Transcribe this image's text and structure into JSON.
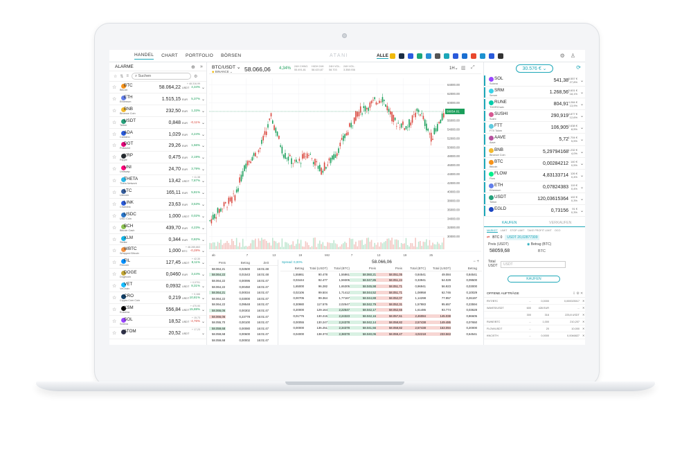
{
  "nav": {
    "tabs": [
      "HANDEL",
      "CHART",
      "PORTFOLIO",
      "BÖRSEN"
    ],
    "logo": "ATANI",
    "alle": "ALLE"
  },
  "colors": {
    "accent": "#1ca7b8",
    "up": "#1a9e5a",
    "down": "#d9453b"
  },
  "alarme": {
    "title": "ALARME",
    "search_placeholder": "Suchen"
  },
  "watchlist": [
    {
      "sym": "BTC",
      "name": "Bitcoin",
      "price": "58.064,22",
      "cur": "USDT",
      "chg": "4,34%",
      "top": "+ 48.316,99",
      "dir": "pos",
      "color": "#f7931a"
    },
    {
      "sym": "ETH",
      "name": "Ethereum",
      "price": "1.515,15",
      "cur": "EUR",
      "chg": "5,37%",
      "dir": "pos",
      "color": "#627eea"
    },
    {
      "sym": "BNB",
      "name": "Binance Coin",
      "price": "232,50",
      "cur": "EUR",
      "chg": "1,33%",
      "dir": "pos",
      "color": "#f3ba2f"
    },
    {
      "sym": "USDT",
      "name": "Tether",
      "price": "0,848",
      "cur": "EUR",
      "chg": "-0,11%",
      "dir": "neg",
      "color": "#26a17b"
    },
    {
      "sym": "ADA",
      "name": "Cardano",
      "price": "1,029",
      "cur": "EUR",
      "chg": "4,24%",
      "dir": "pos",
      "color": "#2a5ada"
    },
    {
      "sym": "DOT",
      "name": "Polkadot",
      "price": "29,26",
      "cur": "EUR",
      "chg": "1,56%",
      "dir": "pos",
      "color": "#e6007a"
    },
    {
      "sym": "XRP",
      "name": "Ripple",
      "price": "0,475",
      "cur": "EUR",
      "chg": "2,19%",
      "dir": "pos",
      "color": "#23292f"
    },
    {
      "sym": "UNI",
      "name": "Uniswap",
      "price": "24,70",
      "cur": "EUR",
      "chg": "3,79%",
      "dir": "pos",
      "color": "#ff007a"
    },
    {
      "sym": "THETA",
      "name": "Theta Network",
      "price": "13,42",
      "cur": "USDT",
      "chg": "7,87%",
      "top": "+ 11,38",
      "dir": "pos",
      "color": "#2ab8e6"
    },
    {
      "sym": "LTC",
      "name": "Litecoin",
      "price": "165,11",
      "cur": "EUR",
      "chg": "5,81%",
      "dir": "pos",
      "color": "#345d9d"
    },
    {
      "sym": "LINK",
      "name": "Chainlink",
      "price": "23,63",
      "cur": "EUR",
      "chg": "3,53%",
      "dir": "pos",
      "color": "#2a5ada"
    },
    {
      "sym": "USDC",
      "name": "USD Coin",
      "price": "1,000",
      "cur": "USDT",
      "chg": "0,02%",
      "dir": "pos",
      "color": "#2775ca"
    },
    {
      "sym": "BCH",
      "name": "Bitcoin Cash",
      "price": "439,70",
      "cur": "EUR",
      "chg": "4,23%",
      "dir": "pos",
      "color": "#8dc351"
    },
    {
      "sym": "XLM",
      "name": "Stellar",
      "price": "0,344",
      "cur": "EUR",
      "chg": "0,82%",
      "dir": "pos",
      "color": "#14b6e7"
    },
    {
      "sym": "WBTC",
      "name": "Wrapped Bitcoin",
      "price": "1,000",
      "cur": "BTC",
      "chg": "-0,28%",
      "top": "+ 48.285,863",
      "dir": "neg",
      "color": "#f09242"
    },
    {
      "sym": "FIL",
      "name": "Filecoin",
      "price": "127,45",
      "cur": "USDT",
      "chg": "8,11%",
      "top": "+ 42,30",
      "dir": "pos",
      "color": "#0090ff"
    },
    {
      "sym": "DOGE",
      "name": "Dogecoin",
      "price": "0,0460",
      "cur": "EUR",
      "chg": "3,44%",
      "dir": "pos",
      "color": "#c2a633"
    },
    {
      "sym": "VET",
      "name": "VeChain",
      "price": "0,0932",
      "cur": "USDT",
      "chg": "8,31%",
      "top": "+ 0,0701",
      "dir": "pos",
      "color": "#15bdff"
    },
    {
      "sym": "CRO",
      "name": "Crypto.Com Coin",
      "price": "0,219",
      "cur": "USDT",
      "chg": "10,81%",
      "top": "+ 0,166",
      "dir": "pos",
      "color": "#103f68"
    },
    {
      "sym": "KSM",
      "name": "Kusama",
      "price": "556,84",
      "cur": "USDT",
      "chg": "15,88%",
      "top": "+ 470,90",
      "dir": "pos",
      "color": "#000"
    },
    {
      "sym": "SOL",
      "name": "Solana",
      "price": "18,52",
      "cur": "USDT",
      "chg": "-4,76%",
      "top": "+ 15,73",
      "dir": "neg",
      "color": "#9945ff"
    },
    {
      "sym": "ATOM",
      "name": "",
      "price": "20,52",
      "cur": "USDT",
      "chg": "",
      "top": "+ 17,23",
      "dir": "pos",
      "color": "#2e3148"
    }
  ],
  "chart": {
    "pair": "BTC/USDT",
    "exchange": "BINANCE",
    "price": "58.066,06",
    "pct": "4,34%",
    "interval": "1H",
    "stats": [
      {
        "l": "24H CHNG.",
        "v": "55.491,81"
      },
      {
        "l": "HIGH 24H",
        "v": "58.420,87"
      },
      {
        "l": "24H VOL.",
        "v": "58.703"
      },
      {
        "l": "24H VOL.",
        "v": "3.358.936"
      }
    ],
    "current_label": "58054.01",
    "x_labels": [
      "ab",
      "7",
      "13",
      "19",
      "Mrz",
      "7",
      "13",
      "19",
      "25"
    ],
    "y_labels": [
      "64000.00",
      "62000.00",
      "60000.00",
      "58000.00",
      "56000.00",
      "54000.00",
      "52000.00",
      "50000.00",
      "48000.00",
      "46000.00",
      "44000.00",
      "42000.00",
      "40000.00",
      "38000.00",
      "36000.00",
      "34000.00",
      "32000.00",
      "30000.00"
    ]
  },
  "chart_data": {
    "type": "line",
    "title": "",
    "ylim": [
      29000,
      65500
    ],
    "x": [
      "ab",
      "7",
      "13",
      "19",
      "Mrz",
      "7",
      "13",
      "19",
      "25"
    ],
    "series": [
      {
        "values": [
          33500,
          36500,
          38800,
          46800,
          49200,
          56800,
          48500,
          46200,
          48800,
          44800,
          47500,
          52500,
          57800,
          59500,
          61200,
          55800,
          54500,
          58400,
          52200,
          57200
        ]
      }
    ]
  },
  "orderbook": {
    "headers": [
      "Preis",
      "Betrag",
      "Zeit"
    ],
    "rows": [
      [
        "58.064,21",
        "0,02500",
        "16:01:48"
      ],
      [
        "58.064,22",
        "0,01543",
        "16:01:48"
      ],
      [
        "58.064,22",
        "0,00095",
        "16:01:47"
      ],
      [
        "58.064,22",
        "0,00450",
        "16:01:47"
      ],
      [
        "58.064,21",
        "0,00034",
        "16:01:47"
      ],
      [
        "58.064,22",
        "0,03000",
        "16:01:47"
      ],
      [
        "58.064,22",
        "0,09548",
        "16:01:47"
      ],
      [
        "58.066,06",
        "0,00302",
        "16:01:47"
      ],
      [
        "58.066,06",
        "0,23778",
        "16:01:47"
      ],
      [
        "58.055,70",
        "0,00100",
        "16:01:47"
      ],
      [
        "58.059,68",
        "0,00080",
        "16:01:47"
      ],
      [
        "58.059,68",
        "0,00600",
        "16:01:47"
      ],
      [
        "58.059,68",
        "0,00002",
        "16:01:47"
      ]
    ]
  },
  "trades": {
    "spread": "Spread: 0,00%",
    "mid": "58.066,06",
    "headers": [
      "Betrag",
      "Total (USDT)",
      "Total (BTC)",
      "Preis",
      "Preis",
      "Total (BTC)",
      "Total (USDT)",
      "Betrag"
    ],
    "rows": [
      [
        "1,55861",
        "90.478",
        "1,55861",
        "58.060,21",
        "58.051,05",
        "0,84541",
        "49.084",
        "0,84541"
      ],
      [
        "0,03444",
        "92.477",
        "1,59305",
        "58.047,85",
        "58.051,24",
        "0,33941",
        "54.029",
        "0,09500"
      ],
      [
        "1,65000",
        "96.282",
        "1,65305",
        "58.045,98",
        "58.051,71",
        "0,96941",
        "56.923",
        "0,03000"
      ],
      [
        "0,02106",
        "99.504",
        "1,71412",
        "58.044,52",
        "58.051,71",
        "1,08958",
        "62.746",
        "0,10029"
      ],
      [
        "0,00705",
        "99.364",
        "1,77167",
        "58.044,88",
        "58.052,07",
        "1,14298",
        "77.957",
        "0,26197"
      ],
      [
        "0,30980",
        "117.576",
        "2,02547",
        "58.042,79",
        "58.052,31",
        "1,57883",
        "95.657",
        "0,23594"
      ],
      [
        "0,20000",
        "129.164",
        "2,22547",
        "58.042,17",
        "58.052,65",
        "1,61486",
        "93.774",
        "0,03628"
      ],
      [
        "0,01776",
        "130.215",
        "2,24323",
        "58.042,16",
        "58.057,61",
        "2,46084",
        "145.038",
        "0,86605"
      ],
      [
        "0,00055",
        "130.247",
        "2,24378",
        "58.042,14",
        "58.058,82",
        "2,57438",
        "149.486",
        "0,07650"
      ],
      [
        "0,00000",
        "136.251",
        "2,34378",
        "58.041,56",
        "58.058,82",
        "2,57438",
        "153.094",
        "0,20000"
      ],
      [
        "0,04000",
        "138.373",
        "2,38378",
        "58.040,06",
        "58.059,47",
        "4,02218",
        "233.563",
        "0,64541"
      ]
    ]
  },
  "portfolio": {
    "balance": "30.576 €",
    "assets": [
      {
        "sym": "SOL",
        "name": "Solana",
        "amount": "541,38",
        "v1": "8.557 €",
        "v2": "27,8%",
        "color": "#9945ff"
      },
      {
        "sym": "SRM",
        "name": "Serum",
        "amount": "1.268,56",
        "v1": "5.601 €",
        "v2": "18,1%",
        "color": "#3ad2e8"
      },
      {
        "sym": "RUNE",
        "name": "THORChain",
        "amount": "804,91",
        "v1": "4.284 €",
        "v2": "13,9%",
        "color": "#00ccab"
      },
      {
        "sym": "SUSHI",
        "name": "Sushi",
        "amount": "290,919",
        "v1": "3.877 €",
        "v2": "12,6%",
        "color": "#d65892"
      },
      {
        "sym": "FTT",
        "name": "FTX Token",
        "amount": "106,905",
        "v1": "2.638 €",
        "v2": "8,5%",
        "color": "#5fcade"
      },
      {
        "sym": "AAVE",
        "name": "Aave",
        "amount": "5,72",
        "v1": "1.704 €",
        "v2": "5,5%",
        "color": "#b6509e"
      },
      {
        "sym": "BNB",
        "name": "Binance Coin",
        "amount": "5,29794168",
        "v1": "1.232 €",
        "v2": "4,0%",
        "color": "#f3ba2f"
      },
      {
        "sym": "BTC",
        "name": "Bitcoin",
        "amount": "0,00284212",
        "v1": "140 €",
        "v2": "0,5%",
        "color": "#f7931a"
      },
      {
        "sym": "FLOW",
        "name": "Flow",
        "amount": "4,83133714",
        "v1": "126 €",
        "v2": "0,4%",
        "color": "#00ef8b"
      },
      {
        "sym": "ETH",
        "name": "Ethereum",
        "amount": "0,07824383",
        "v1": "119 €",
        "v2": "0,4%",
        "color": "#627eea"
      },
      {
        "sym": "USDT",
        "name": "Tether",
        "amount": "120,03615364",
        "v1": "102 €",
        "v2": "0,3%",
        "color": "#26a17b"
      },
      {
        "sym": "EGLD",
        "name": "",
        "amount": "0,73156",
        "v1": "91 €",
        "v2": "0,3%",
        "color": "#1b46c2"
      }
    ]
  },
  "trade_form": {
    "buy": "KAUFEN",
    "sell": "VERKAUFEN",
    "types": [
      "MARKET",
      "LIMIT",
      "STOP LIMIT",
      "TAKE PROFIT LIMIT",
      "OCO"
    ],
    "btc_val": "BTC 0",
    "usdt_val": "USDT 20,02877309",
    "price_label": "Preis (USDT)",
    "amount_label": "Betrag (BTC)",
    "price": "58059,68",
    "unit": "BTC",
    "total_label": "Total",
    "total_unit": "USDT",
    "total_placeholder": "USDT",
    "submit": "KAUFEN"
  },
  "open_orders": {
    "title": "OFFENE AUFTRÄGE",
    "headers": [
      "Prei",
      "Total"
    ],
    "rows": [
      [
        "RVT/BTC",
        "...",
        "0,0000",
        "0,000023017"
      ],
      [
        "WAVES/USDT",
        "600",
        "428 EUR",
        "..."
      ],
      [
        "",
        "300",
        "316",
        "225,8 USDT"
      ],
      [
        "RUNE/BTC",
        "...",
        "1,000",
        "210,207"
      ],
      [
        "FLOW/USDT",
        "...",
        "20",
        "10,000"
      ],
      [
        "KNC/ETH",
        "...",
        "0,0000",
        "0,0046827"
      ]
    ]
  }
}
